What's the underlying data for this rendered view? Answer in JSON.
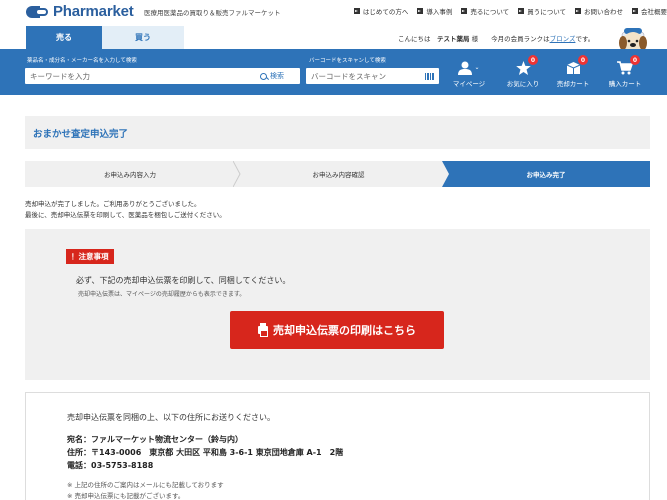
{
  "brand": {
    "name": "Pharmarket",
    "tagline": "医療用医薬品の買取り＆販売ファルマーケット"
  },
  "top_links": [
    "はじめての方へ",
    "導入事例",
    "売るについて",
    "買うについて",
    "お問い合わせ",
    "会社概要"
  ],
  "tabs": {
    "sell": "売る",
    "buy": "買う"
  },
  "greeting": {
    "prefix": "こんにちは",
    "user": "テスト薬局",
    "honorific": "様",
    "rank_prefix": "今月の会員ランクは",
    "rank": "ブロンズ",
    "rank_suffix": "です。"
  },
  "search": {
    "keyword_label": "薬品名・成分名・メーカー名を入力して検索",
    "keyword_placeholder": "キーワードを入力",
    "search_button": "検索",
    "barcode_label": "バーコードをスキャンして検索",
    "barcode_placeholder": "バーコードをスキャン"
  },
  "header_icons": {
    "mypage": "マイページ",
    "favorites": "お気に入り",
    "favorites_count": "0",
    "sell_cart": "売却カート",
    "sell_cart_count": "0",
    "buy_cart": "購入カート",
    "buy_cart_count": "0"
  },
  "page_title": "おまかせ査定申込完了",
  "steps": [
    "お申込み内容入力",
    "お申込み内容確認",
    "お申込み完了"
  ],
  "complete_message": {
    "line1": "売却申込が完了しました。ご利用ありがとうございました。",
    "line2": "最後に、売却申込伝票を印刷して、医薬品を梱包しご送付ください。"
  },
  "notice": {
    "tag": "！注意事項",
    "main": "必ず、下記の売却申込伝票を印刷して、同梱してください。",
    "sub": "売却申込伝票は、マイページの売却履歴からも表示できます。",
    "print_button": "売却申込伝票の印刷はこちら"
  },
  "address": {
    "intro": "売却申込伝票を同梱の上、以下の住所にお送りください。",
    "recipient": "宛名：ファルマーケット物流センター（鈴与内）",
    "address": "住所：〒143-0006　東京都 大田区 平和島 3-6-1 東京団地倉庫 A-1　2階",
    "phone": "電話：03-5753-8188",
    "note1": "※ 上記の住所のご案内はメールにも記載しております",
    "note2": "※ 売却申込伝票にも記載がございます。"
  },
  "colors": {
    "primary": "#2e73b8",
    "alert": "#d7261c",
    "panel": "#f0f0f0"
  }
}
